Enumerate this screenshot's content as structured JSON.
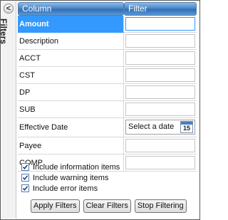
{
  "panel": {
    "title": "Filters",
    "collapse_glyph": "<"
  },
  "grid": {
    "columns": [
      "Column",
      "Filter"
    ],
    "rows": [
      {
        "name": "Amount",
        "filter": ""
      },
      {
        "name": "Description",
        "filter": ""
      },
      {
        "name": "ACCT",
        "filter": ""
      },
      {
        "name": "CST",
        "filter": ""
      },
      {
        "name": "DP",
        "filter": ""
      },
      {
        "name": "SUB",
        "filter": ""
      },
      {
        "name": "Effective Date",
        "filter": "Select a date",
        "calendar_day": "15"
      },
      {
        "name": "Payee",
        "filter": ""
      },
      {
        "name": "COMP",
        "filter": ""
      }
    ],
    "selected_row": "Amount"
  },
  "options": [
    {
      "label": "Include information items",
      "checked": true
    },
    {
      "label": "Include warning items",
      "checked": true
    },
    {
      "label": "Include error items",
      "checked": true
    }
  ],
  "buttons": {
    "apply": "Apply Filters",
    "clear": "Clear Filters",
    "stop": "Stop Filtering"
  },
  "colors": {
    "header": "#4a86c8",
    "selection": "#3399ff"
  }
}
